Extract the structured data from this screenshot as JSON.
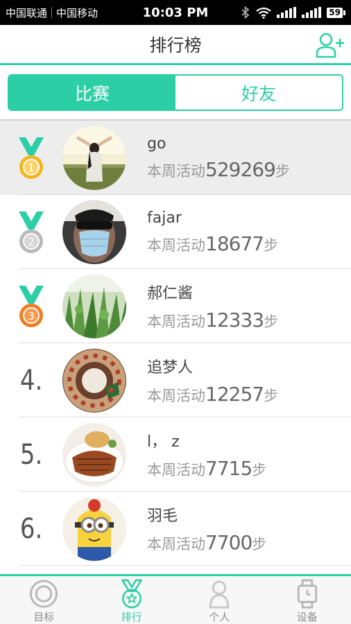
{
  "status_bar": {
    "carrier1": "中国联通",
    "carrier2": "中国移动",
    "time": "10:03 PM",
    "battery": "59"
  },
  "header": {
    "title": "排行榜"
  },
  "tabs": [
    {
      "label": "比赛",
      "active": true
    },
    {
      "label": "好友",
      "active": false
    }
  ],
  "activity_prefix": "本周活动",
  "steps_suffix": "步",
  "ranking": [
    {
      "rank": "1",
      "medal": "gold",
      "name": "go",
      "steps": "529269",
      "highlighted": true
    },
    {
      "rank": "2",
      "medal": "silver",
      "name": "fajar",
      "steps": "18677"
    },
    {
      "rank": "3",
      "medal": "bronze",
      "name": "郝仁酱",
      "steps": "12333"
    },
    {
      "rank": "4.",
      "name": "追梦人",
      "steps": "12257"
    },
    {
      "rank": "5.",
      "name": "l， z",
      "steps": "7715"
    },
    {
      "rank": "6.",
      "name": "羽毛",
      "steps": "7700"
    }
  ],
  "bottom_nav": [
    {
      "label": "目标",
      "icon": "target-icon",
      "active": false
    },
    {
      "label": "排行",
      "icon": "ranking-medal-icon",
      "active": true
    },
    {
      "label": "个人",
      "icon": "person-icon",
      "active": false
    },
    {
      "label": "设备",
      "icon": "watch-device-icon",
      "active": false
    }
  ],
  "colors": {
    "accent": "#2ccfa5",
    "gold": "#f5b51e",
    "silver": "#b9b9b9",
    "bronze": "#ef7d21"
  }
}
